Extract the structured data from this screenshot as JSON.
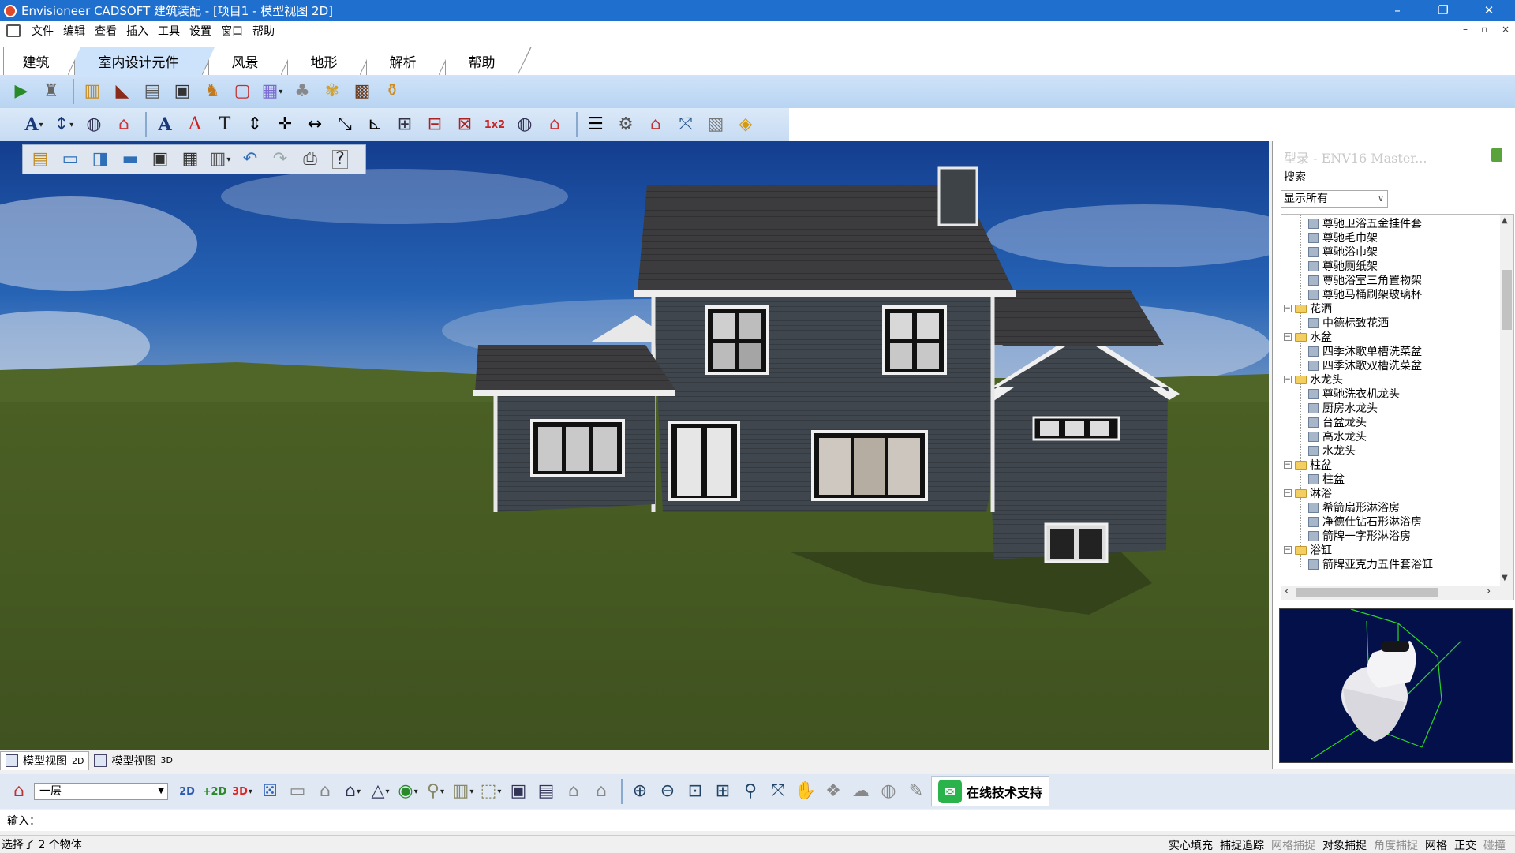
{
  "window": {
    "title": "Envisioneer CADSOFT 建筑装配 - [项目1 - 模型视图 2D]",
    "controls": [
      "–",
      "❐",
      "✕"
    ]
  },
  "menu": [
    "文件",
    "编辑",
    "查看",
    "插入",
    "工具",
    "设置",
    "窗口",
    "帮助"
  ],
  "mdi_controls": [
    "–",
    "▫",
    "×"
  ],
  "ribbon_tabs": [
    "建筑",
    "室内设计元件",
    "风景",
    "地形",
    "解析",
    "帮助"
  ],
  "active_tab": "室内设计元件",
  "catalog_panel": {
    "title": "型录 - ENV16 Master...",
    "search_label": "搜索",
    "filter_value": "显示所有",
    "tree": [
      {
        "level": 2,
        "type": "item",
        "label": "尊驰卫浴五金挂件套"
      },
      {
        "level": 2,
        "type": "item",
        "label": "尊驰毛巾架"
      },
      {
        "level": 2,
        "type": "item",
        "label": "尊驰浴巾架"
      },
      {
        "level": 2,
        "type": "item",
        "label": "尊驰厕纸架"
      },
      {
        "level": 2,
        "type": "item",
        "label": "尊驰浴室三角置物架"
      },
      {
        "level": 2,
        "type": "item",
        "label": "尊驰马桶刷架玻璃杯"
      },
      {
        "level": 1,
        "type": "folder",
        "label": "花洒"
      },
      {
        "level": 2,
        "type": "item",
        "label": "中德标致花洒"
      },
      {
        "level": 1,
        "type": "folder",
        "label": "水盆"
      },
      {
        "level": 2,
        "type": "item",
        "label": "四季沐歌单槽洗菜盆"
      },
      {
        "level": 2,
        "type": "item",
        "label": "四季沐歌双槽洗菜盆"
      },
      {
        "level": 1,
        "type": "folder",
        "label": "水龙头"
      },
      {
        "level": 2,
        "type": "item",
        "label": "尊驰洗衣机龙头"
      },
      {
        "level": 2,
        "type": "item",
        "label": "厨房水龙头"
      },
      {
        "level": 2,
        "type": "item",
        "label": "台盆龙头"
      },
      {
        "level": 2,
        "type": "item",
        "label": "高水龙头"
      },
      {
        "level": 2,
        "type": "item",
        "label": "水龙头"
      },
      {
        "level": 1,
        "type": "folder",
        "label": "柱盆"
      },
      {
        "level": 2,
        "type": "item",
        "label": "柱盆"
      },
      {
        "level": 1,
        "type": "folder",
        "label": "淋浴"
      },
      {
        "level": 2,
        "type": "item",
        "label": "希箭扇形淋浴房"
      },
      {
        "level": 2,
        "type": "item",
        "label": "净德仕钻石形淋浴房"
      },
      {
        "level": 2,
        "type": "item",
        "label": "箭牌一字形淋浴房"
      },
      {
        "level": 1,
        "type": "folder",
        "label": "浴缸"
      },
      {
        "level": 2,
        "type": "item",
        "label": "箭牌亚克力五件套浴缸"
      }
    ]
  },
  "view_tabs": [
    {
      "label": "模型视图",
      "suffix": "2D",
      "active": true
    },
    {
      "label": "模型视图",
      "suffix": "3D",
      "active": false
    }
  ],
  "floor_select": {
    "value": "一层"
  },
  "support_button": {
    "label": "在线技术支持"
  },
  "input_label": "输入：",
  "status": {
    "message": "选择了 2 个物体",
    "modes": [
      {
        "label": "实心填充",
        "on": true
      },
      {
        "label": "捕捉追踪",
        "on": true
      },
      {
        "label": "网格捕捉",
        "on": false
      },
      {
        "label": "对象捕捉",
        "on": true
      },
      {
        "label": "角度捕捉",
        "on": false
      },
      {
        "label": "网格",
        "on": true
      },
      {
        "label": "正交",
        "on": true
      },
      {
        "label": "碰撞",
        "on": false
      }
    ]
  },
  "icons": {
    "toolbar1": [
      "select-arrow-icon",
      "brush-icon",
      "cabinet-icon",
      "piano-icon",
      "stove-icon",
      "tv-icon",
      "chair-icon",
      "frame-icon",
      "picture-icon",
      "lamp-icon",
      "fan-icon",
      "fireplace-icon",
      "bath-fixture-icon"
    ],
    "toolbar2": [
      "text-style-icon",
      "dimension-icon",
      "symbol-icon",
      "help-symbol-icon",
      "text-icon",
      "text-edit-icon",
      "text-tool-icon",
      "dim-vertical-icon",
      "dim-cross-icon",
      "dim-horizontal-icon",
      "dim-angle-icon",
      "dim-stair-icon",
      "grid-icon",
      "ruler-icon",
      "ruler-2-icon",
      "scale-icon",
      "symbol-2-icon",
      "help-2-icon",
      "list-icon",
      "settings-icon",
      "house-settings-icon",
      "zoom-extents-icon",
      "report-icon",
      "layers-icon"
    ],
    "floatbar": [
      "new-icon",
      "open-icon",
      "open-recent-icon",
      "folder-icon",
      "save-icon",
      "save-as-icon",
      "catalog-icon",
      "undo-icon",
      "redo-icon",
      "print-icon",
      "help-icon"
    ],
    "bottombar": [
      "floor-icon",
      "view-2d-icon",
      "view-2d-plus-icon",
      "view-3d-icon",
      "render-icon",
      "present-icon",
      "house-icon",
      "house-outline-icon",
      "roof-icon",
      "camera-icon",
      "light-icon",
      "wall-icon",
      "box-icon",
      "display-icon",
      "display-2-icon",
      "house-3-icon",
      "house-4-icon",
      "zoom-in-icon",
      "zoom-out-icon",
      "zoom-box-icon",
      "zoom-window-icon",
      "zoom-icon",
      "zoom-extents-2-icon",
      "pan-icon",
      "walk-icon",
      "orbit-icon",
      "camera-2-icon",
      "snapshot-icon"
    ]
  },
  "colors": {
    "titlebar": "#1f6fcf",
    "sky": "#1b4fa3",
    "grass": "#4a5e23",
    "siding": "#3e454b",
    "roof": "#3a3a3a",
    "trim": "#f2f2f2"
  }
}
